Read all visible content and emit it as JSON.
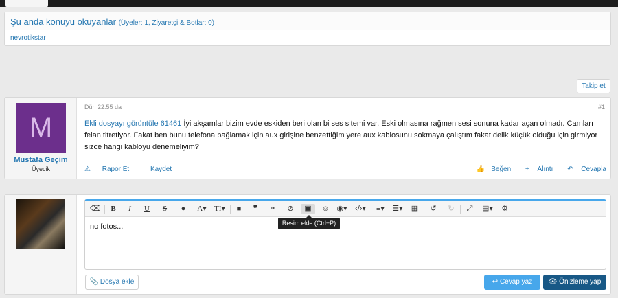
{
  "viewers": {
    "title": "Şu anda konuyu okuyanlar",
    "subtitle": "(Üyeler: 1, Ziyaretçi & Botlar: 0)",
    "member": "nevrotikstar"
  },
  "follow_label": "Takip et",
  "post": {
    "avatar_letter": "M",
    "author": "Mustafa Geçim",
    "role": "Üyecik",
    "time": "Dün 22:55 da",
    "number": "#1",
    "attachment_link": "Ekli dosyayı görüntüle 61461",
    "text": " İyi akşamlar bizim evde eskiden beri olan bi ses sitemi var. Eski olmasına rağmen sesi sonuna kadar açan olmadı. Camları felan titretiyor. Fakat ben bunu telefona bağlamak için aux girişine benzettiğim yere aux kablosunu sokmaya çalıştım fakat delik küçük olduğu için girmiyor sizce hangi kabloyu denemeliyim?",
    "report": "Rapor Et",
    "save": "Kaydet",
    "like": "Beğen",
    "quote": "Alıntı",
    "reply": "Cevapla"
  },
  "reply_box": {
    "text": "no fotos...",
    "tooltip": "Resim ekle (Ctrl+P)",
    "attach_label": "Dosya ekle",
    "submit_label": "Cevap yaz",
    "preview_label": "Önizleme yap"
  },
  "colors": {
    "link": "#2577b1",
    "accent": "#47a7eb",
    "dark_button": "#185886",
    "avatar": "#6c2f8c"
  }
}
